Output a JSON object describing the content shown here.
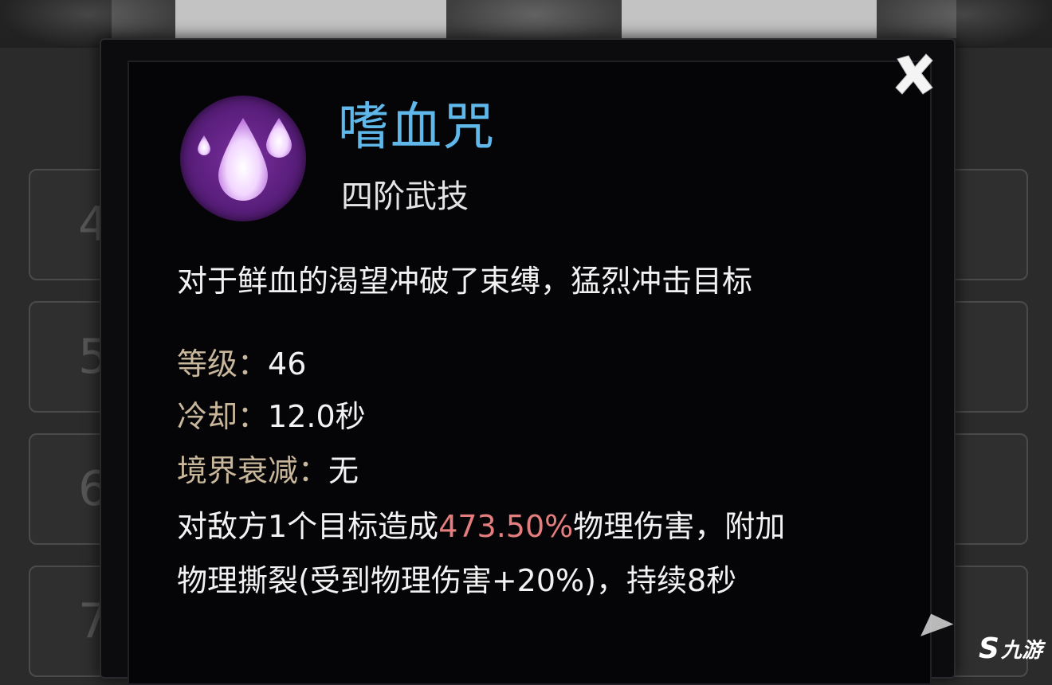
{
  "skill": {
    "name": "嗜血咒",
    "tier": "四阶武技",
    "description": "对于鲜血的渴望冲破了束缚，猛烈冲击目标",
    "icon": "blood-drops-icon",
    "icon_color": "#6a2690",
    "name_color": "#5fb7ea"
  },
  "stats": {
    "level_label": "等级：",
    "level_value": "46",
    "cooldown_label": "冷却：",
    "cooldown_value": "12.0秒",
    "decay_label": "境界衰减：",
    "decay_value": "无"
  },
  "effect": {
    "line1_prefix": "对敌方1个目标造成",
    "line1_highlight": "473.50%",
    "line1_suffix": "物理伤害，附加",
    "line2": "物理撕裂(受到物理伤害+20%)，持续8秒",
    "highlight_color": "#e47e7e"
  },
  "background": {
    "slot_labels_left": [
      "4",
      "5",
      "6",
      "7"
    ]
  },
  "watermark": {
    "text": "九游",
    "mark": "S"
  }
}
